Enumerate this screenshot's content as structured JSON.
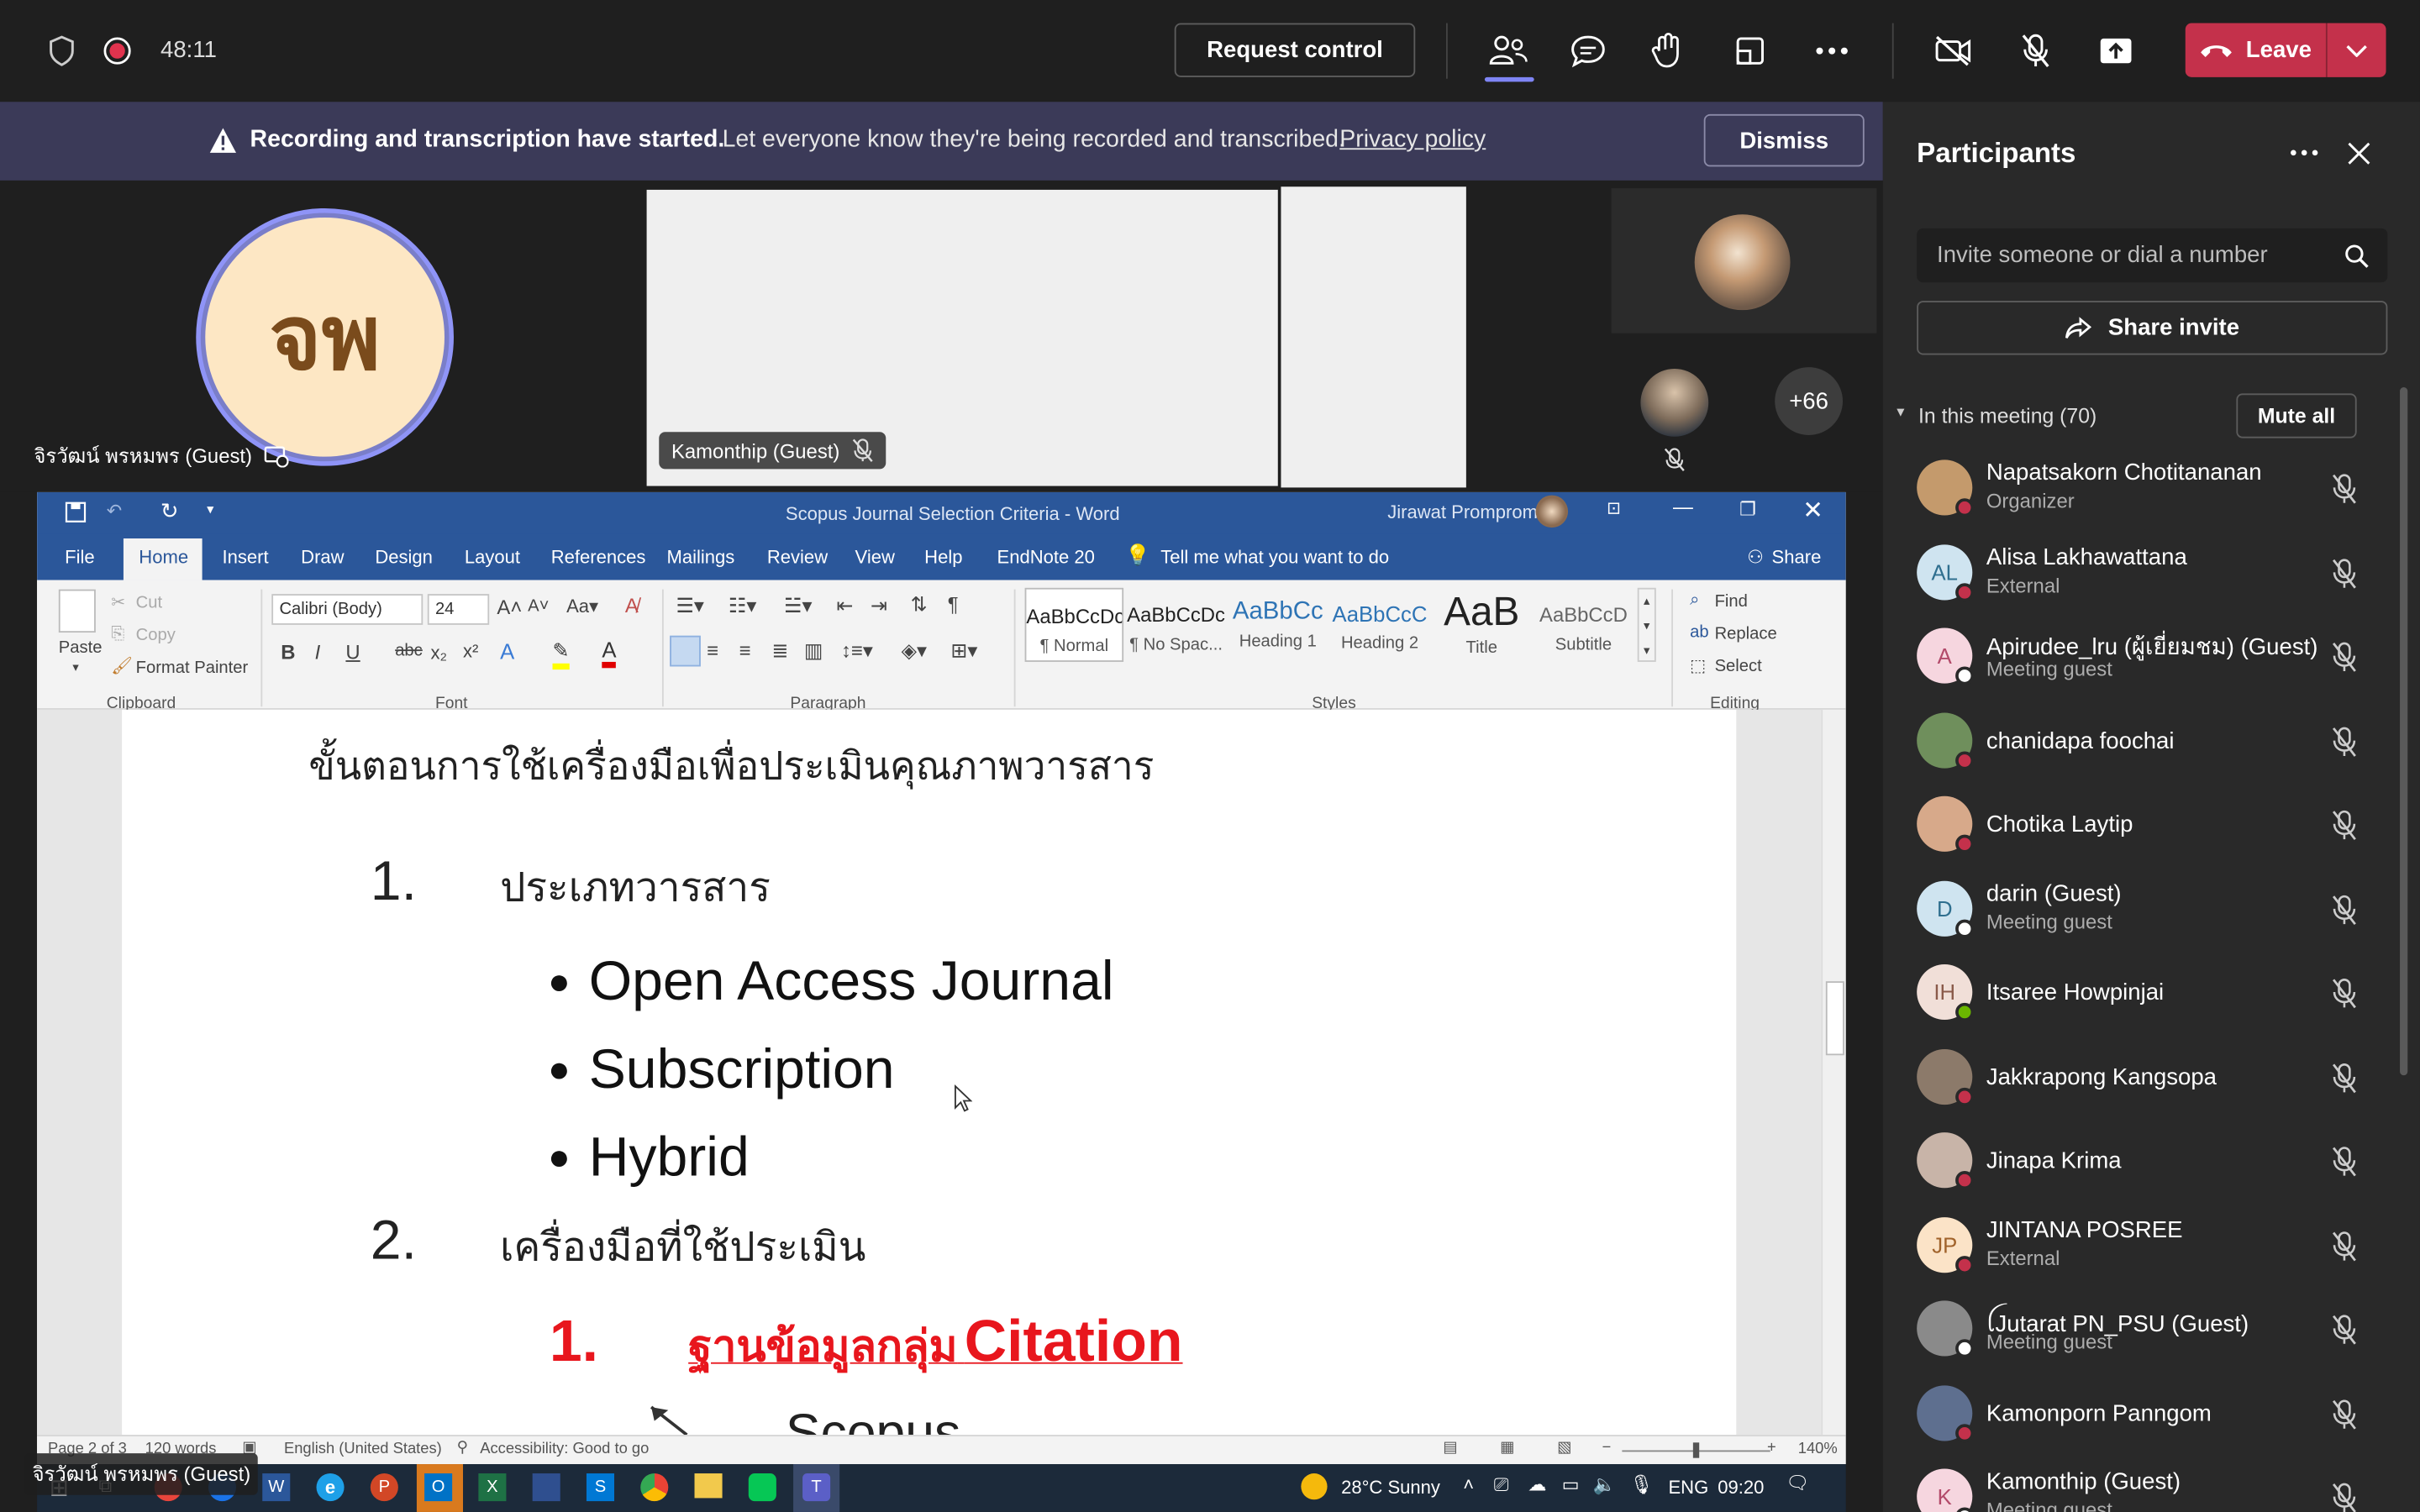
{
  "topbar": {
    "timer": "48:11",
    "request_control": "Request control",
    "leave": "Leave"
  },
  "banner": {
    "bold": "Recording and transcription have started.",
    "text": "Let everyone know they're being recorded and transcribed.",
    "link": "Privacy policy",
    "dismiss": "Dismiss"
  },
  "videos": {
    "main_initials": "จพ",
    "main_name": "จิรวัฒน์ พรหมพร (Guest)",
    "center_name": "Kamonthip (Guest)",
    "more_count": "+66"
  },
  "word": {
    "title": "Scopus Journal Selection Criteria  -  Word",
    "user": "Jirawat Promprom",
    "tabs": [
      "File",
      "Home",
      "Insert",
      "Draw",
      "Design",
      "Layout",
      "References",
      "Mailings",
      "Review",
      "View",
      "Help",
      "EndNote 20"
    ],
    "tell_me": "Tell me what you want to do",
    "share": "Share",
    "clipboard": {
      "paste": "Paste",
      "cut": "Cut",
      "copy": "Copy",
      "format_painter": "Format Painter",
      "label": "Clipboard"
    },
    "font": {
      "name": "Calibri (Body)",
      "size": "24",
      "label": "Font"
    },
    "paragraph_label": "Paragraph",
    "styles": [
      {
        "preview": "AaBbCcDc",
        "name": "¶ Normal"
      },
      {
        "preview": "AaBbCcDc",
        "name": "¶ No Spac..."
      },
      {
        "preview": "AaBbCc",
        "name": "Heading 1"
      },
      {
        "preview": "AaBbCcC",
        "name": "Heading 2"
      },
      {
        "preview": "AaB",
        "name": "Title"
      },
      {
        "preview": "AaBbCcD",
        "name": "Subtitle"
      }
    ],
    "styles_label": "Styles",
    "editing": {
      "find": "Find",
      "replace": "Replace",
      "select": "Select",
      "label": "Editing"
    },
    "doc": {
      "heading": "ขั้นตอนการใช้เครื่องมือเพื่อประเมินคุณภาพวารสาร",
      "item1_num": "1.",
      "item1": "ประเภทวารสาร",
      "bullets": [
        "Open Access Journal",
        "Subscription",
        "Hybrid"
      ],
      "item2_num": "2.",
      "item2": "เครื่องมือที่ใช้ประเมิน",
      "sub1_num": "1.",
      "sub1_thai": "ฐานข้อมูลกลุ่ม",
      "sub1_en": "Citation",
      "cut_text": "Scopus"
    },
    "status": {
      "page": "Page 2 of 3",
      "words": "120 words",
      "lang": "English (United States)",
      "access": "Accessibility: Good to go",
      "zoom": "140%"
    }
  },
  "taskbar": {
    "weather": "28°C  Sunny",
    "lang": "ENG",
    "time": "09:20",
    "overlay_name": "จิรวัฒน์ พรหมพร (Guest)"
  },
  "panel": {
    "title": "Participants",
    "invite_placeholder": "Invite someone or dial a number",
    "share_invite": "Share invite",
    "in_meeting": "In this meeting (70)",
    "mute_all": "Mute all",
    "people": [
      {
        "name": "Napatsakorn Chotitananan",
        "role": "Organizer",
        "initials": "",
        "bg": "#c49a6c",
        "status": "#c4314b"
      },
      {
        "name": "Alisa Lakhawattana",
        "role": "External",
        "initials": "AL",
        "bg": "#cfe4f0",
        "color": "#2f6f8f",
        "status": "#c4314b"
      },
      {
        "name": "Apirudee_lru (ผู้เยี่ยมชม) (Guest)",
        "role": "Meeting guest",
        "initials": "A",
        "bg": "#f6d6df",
        "color": "#b34a6a",
        "status": "#ffffff"
      },
      {
        "name": "chanidapa foochai",
        "role": "",
        "initials": "",
        "bg": "#6f8f5c",
        "status": "#c4314b"
      },
      {
        "name": "Chotika Laytip",
        "role": "",
        "initials": "",
        "bg": "#d7a98a",
        "status": "#c4314b"
      },
      {
        "name": "darin (Guest)",
        "role": "Meeting guest",
        "initials": "D",
        "bg": "#cfe4f0",
        "color": "#2f6f8f",
        "status": "#ffffff"
      },
      {
        "name": "Itsaree Howpinjai",
        "role": "",
        "initials": "IH",
        "bg": "#f1dfd8",
        "color": "#8a5a4a",
        "status": "#6bb700"
      },
      {
        "name": "Jakkrapong Kangsopa",
        "role": "",
        "initials": "",
        "bg": "#8c7a6a",
        "status": "#c4314b"
      },
      {
        "name": "Jinapa Krima",
        "role": "",
        "initials": "",
        "bg": "#c8b4a8",
        "status": "#c4314b"
      },
      {
        "name": "JINTANA POSREE",
        "role": "External",
        "initials": "JP",
        "bg": "#fbe3c7",
        "color": "#a0622a",
        "status": "#c4314b"
      },
      {
        "name": "ꪶJutarat PN_PSU (Guest)",
        "role": "Meeting guest",
        "initials": "",
        "bg": "#8a8a8a",
        "status": "#ffffff"
      },
      {
        "name": "Kamonporn Panngom",
        "role": "",
        "initials": "",
        "bg": "#5e6f8f",
        "status": "#c4314b"
      },
      {
        "name": "Kamonthip (Guest)",
        "role": "Meeting guest",
        "initials": "K",
        "bg": "#f6d6df",
        "color": "#b34a6a",
        "status": "#ffffff"
      }
    ]
  }
}
